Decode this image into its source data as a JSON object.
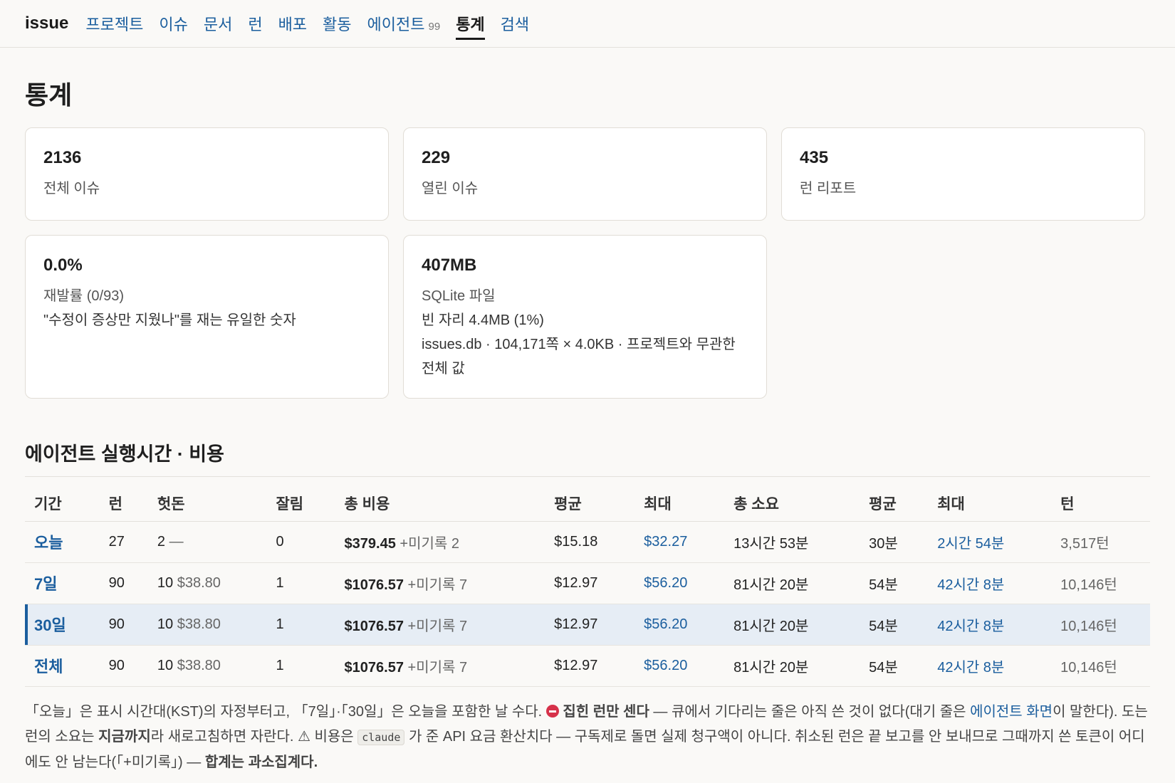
{
  "nav": {
    "brand": "issue",
    "items": [
      {
        "label": "프로젝트"
      },
      {
        "label": "이슈"
      },
      {
        "label": "문서"
      },
      {
        "label": "런"
      },
      {
        "label": "배포"
      },
      {
        "label": "활동"
      },
      {
        "label": "에이전트",
        "badge": "99"
      },
      {
        "label": "통계",
        "active": true
      },
      {
        "label": "검색"
      }
    ]
  },
  "page_title": "통계",
  "cards": [
    {
      "value": "2136",
      "lines": [
        "전체 이슈"
      ]
    },
    {
      "value": "229",
      "lines": [
        "열린 이슈"
      ]
    },
    {
      "value": "435",
      "lines": [
        "런 리포트"
      ]
    },
    {
      "value": "0.0%",
      "lines": [
        "재발률 (0/93)",
        "\"수정이 증상만 지웠나\"를 재는 유일한 숫자"
      ]
    },
    {
      "value": "407MB",
      "lines": [
        "SQLite 파일",
        "빈 자리 4.4MB (1%)",
        "issues.db · 104,171쪽 × 4.0KB · 프로젝트와 무관한",
        "전체 값"
      ]
    }
  ],
  "section_title": "에이전트 실행시간 · 비용",
  "table": {
    "headers": [
      "기간",
      "런",
      "헛돈",
      "잘림",
      "총 비용",
      "평균",
      "최대",
      "총 소요",
      "평균",
      "최대",
      "턴"
    ],
    "rows": [
      {
        "period": "오늘",
        "runs": "27",
        "waste": "2",
        "waste_cost": "—",
        "cut": "0",
        "total": "$379.45",
        "unrecorded": "+미기록 2",
        "avg": "$15.18",
        "max": "$32.27",
        "time_total": "13시간 53분",
        "time_avg": "30분",
        "time_max": "2시간 54분",
        "turns": "3,517턴"
      },
      {
        "period": "7일",
        "runs": "90",
        "waste": "10",
        "waste_cost": "$38.80",
        "cut": "1",
        "total": "$1076.57",
        "unrecorded": "+미기록 7",
        "avg": "$12.97",
        "max": "$56.20",
        "time_total": "81시간 20분",
        "time_avg": "54분",
        "time_max": "42시간 8분",
        "turns": "10,146턴"
      },
      {
        "period": "30일",
        "runs": "90",
        "waste": "10",
        "waste_cost": "$38.80",
        "cut": "1",
        "total": "$1076.57",
        "unrecorded": "+미기록 7",
        "avg": "$12.97",
        "max": "$56.20",
        "time_total": "81시간 20분",
        "time_avg": "54분",
        "time_max": "42시간 8분",
        "turns": "10,146턴",
        "highlight": true
      },
      {
        "period": "전체",
        "runs": "90",
        "waste": "10",
        "waste_cost": "$38.80",
        "cut": "1",
        "total": "$1076.57",
        "unrecorded": "+미기록 7",
        "avg": "$12.97",
        "max": "$56.20",
        "time_total": "81시간 20분",
        "time_avg": "54분",
        "time_max": "42시간 8분",
        "turns": "10,146턴"
      }
    ]
  },
  "footnote": {
    "p1": "「오늘」은 표시 시간대(KST)의 자정부터고, 「7일」·「30일」은 오늘을 포함한 날 수다. ",
    "p2_bold": "집힌 런만 센다",
    "p3": " — 큐에서 기다리는 줄은 아직 쓴 것이 없다(대기 줄은 ",
    "link": "에이전트 화면",
    "p4": "이 말한다). 도는 런의 소요는 ",
    "p5_bold": "지금까지",
    "p6": "라 새로고침하면 자란다. ⚠ 비용은 ",
    "code": "claude",
    "p7": " 가 준 API 요금 환산치다 — 구독제로 돌면 실제 청구액이 아니다. 취소된 런은 끝 보고를 안 보내므로 그때까지 쓴 토큰이 어디에도 안 남는다(「+미기록」) — ",
    "p8_bold": "합계는 과소집계다."
  }
}
